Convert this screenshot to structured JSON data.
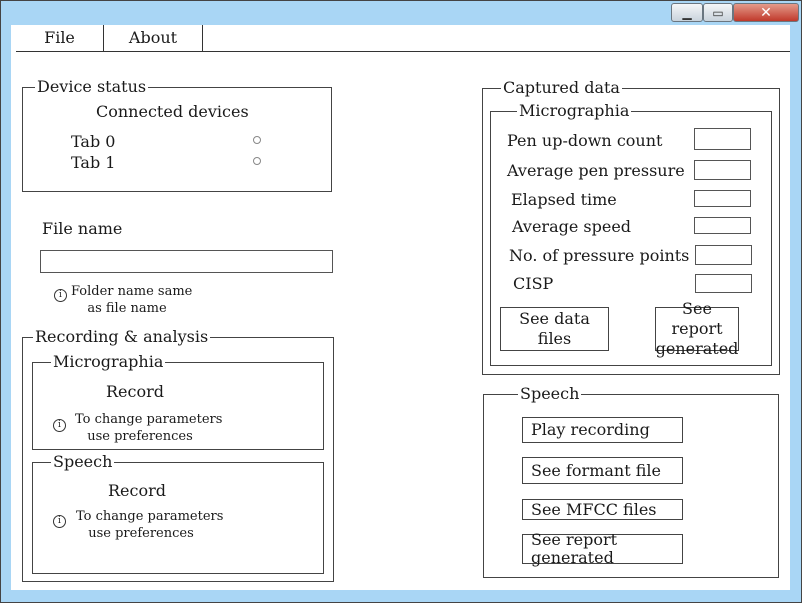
{
  "window": {
    "minimize_glyph": "▁",
    "maximize_glyph": "▭",
    "close_glyph": "✕"
  },
  "menu": {
    "file": "File",
    "about": "About"
  },
  "device_status": {
    "legend": "Device status",
    "heading": "Connected devices",
    "devices": [
      "Tab 0",
      "Tab 1"
    ]
  },
  "file_name": {
    "label": "File name",
    "value": "",
    "info_glyph": "i",
    "hint_line1": "Folder name same",
    "hint_line2": "as file name"
  },
  "recording": {
    "legend": "Recording & analysis",
    "micrographia": {
      "legend": "Micrographia",
      "record": "Record",
      "hint_line1": "To change parameters",
      "hint_line2": "use preferences"
    },
    "speech": {
      "legend": "Speech",
      "record": "Record",
      "hint_line1": "To change parameters",
      "hint_line2": "use preferences"
    }
  },
  "captured": {
    "legend": "Captured data",
    "micrographia": {
      "legend": "Micrographia",
      "metrics": [
        {
          "label": "Pen up-down count",
          "value": ""
        },
        {
          "label": "Average pen pressure",
          "value": ""
        },
        {
          "label": "Elapsed time",
          "value": ""
        },
        {
          "label": "Average speed",
          "value": ""
        },
        {
          "label": "No. of pressure points",
          "value": ""
        },
        {
          "label": "CISP",
          "value": ""
        }
      ],
      "see_data_line1": "See data",
      "see_data_line2": "files",
      "see_report_line1": "See report",
      "see_report_line2": "generated"
    }
  },
  "speech_panel": {
    "legend": "Speech",
    "buttons": [
      "Play recording",
      "See formant file",
      "See MFCC files",
      "See report generated"
    ]
  }
}
